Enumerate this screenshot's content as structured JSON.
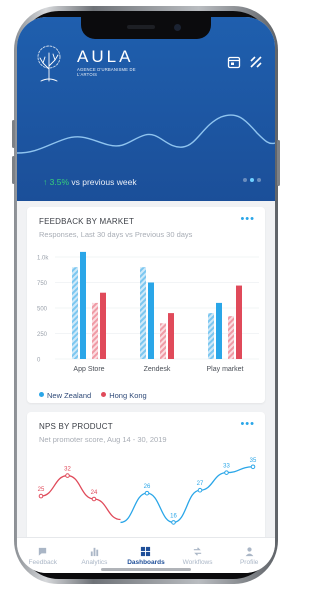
{
  "colors": {
    "brand_blue": "#1f5fae",
    "new_zealand": "#2aa6e8",
    "hong_kong": "#e04a5a",
    "trend_green": "#37d07a"
  },
  "header": {
    "brand": "AULA",
    "brand_sub": "AGENCE D'URBANISME DE L'ARTOIS",
    "icons": [
      "calendar-icon",
      "compare-icon"
    ]
  },
  "hero": {
    "trend_pct": "3.5%",
    "trend_text": "vs previous week",
    "pager_dots": 3,
    "active_dot": 1
  },
  "feedback_card": {
    "title": "FEEDBACK BY MARKET",
    "subtitle": "Responses, Last 30 days vs Previous 30 days",
    "more": "•••"
  },
  "nps_card": {
    "title": "NPS BY PRODUCT",
    "subtitle": "Net promoter score, Aug 14 - 30, 2019",
    "more": "•••"
  },
  "chart_data": [
    {
      "type": "bar",
      "categories": [
        "App Store",
        "Zendesk",
        "Play market"
      ],
      "yticks": [
        "1.0k",
        "750",
        "500",
        "250",
        "0"
      ],
      "ylim": [
        0,
        1000
      ],
      "series": [
        {
          "name": "New Zealand",
          "color": "#2aa6e8",
          "previous": [
            900,
            900,
            450
          ],
          "current": [
            1050,
            750,
            550
          ]
        },
        {
          "name": "Hong Kong",
          "color": "#e04a5a",
          "previous": [
            550,
            350,
            420
          ],
          "current": [
            650,
            450,
            720
          ]
        }
      ],
      "legend": [
        "New Zealand",
        "Hong Kong"
      ]
    },
    {
      "type": "line",
      "series": [
        {
          "color": "#e04a5a",
          "points": [
            {
              "x": 0,
              "y": 25
            },
            {
              "x": 1,
              "y": 32
            },
            {
              "x": 2,
              "y": 24
            },
            {
              "x": 3,
              "y": 17
            }
          ]
        },
        {
          "color": "#2aa6e8",
          "points": [
            {
              "x": 3,
              "y": 16
            },
            {
              "x": 4,
              "y": 26
            },
            {
              "x": 5,
              "y": 16
            },
            {
              "x": 6,
              "y": 27
            },
            {
              "x": 7,
              "y": 33
            },
            {
              "x": 8,
              "y": 35
            }
          ]
        }
      ],
      "labels": [
        "25",
        "32",
        "24",
        "26",
        "16",
        "27",
        "33",
        "35"
      ]
    }
  ],
  "tabbar": {
    "tabs": [
      {
        "label": "Feedback",
        "icon": "chat-icon",
        "active": false
      },
      {
        "label": "Analytics",
        "icon": "bar-chart-icon",
        "active": false
      },
      {
        "label": "Dashboards",
        "icon": "grid-icon",
        "active": true
      },
      {
        "label": "Workflows",
        "icon": "workflow-icon",
        "active": false
      },
      {
        "label": "Profile",
        "icon": "person-icon",
        "active": false
      }
    ]
  }
}
